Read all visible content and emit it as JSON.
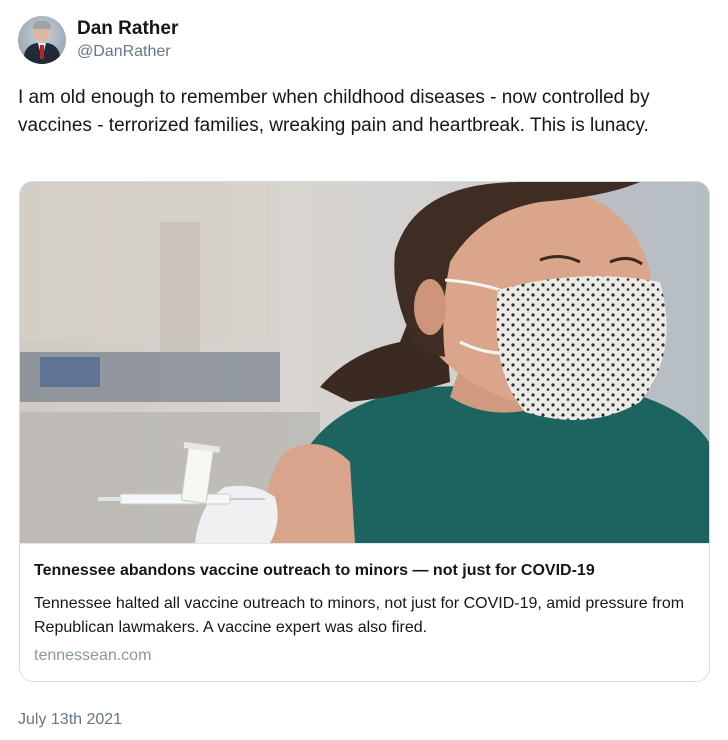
{
  "author": {
    "name": "Dan Rather",
    "handle": "@DanRather"
  },
  "tweet": {
    "text": "I am old enough to remember when childhood diseases - now controlled by vaccines - terrorized families, wreaking pain and heartbreak. This is lunacy.",
    "date": "July 13th 2021"
  },
  "card": {
    "image_icon": "photo-woman-receiving-vaccine",
    "title": "Tennessee abandons vaccine outreach to minors — not just for COVID-19",
    "description": "Tennessee halted all vaccine outreach to minors, not just for COVID-19, amid pressure from Republican lawmakers. A vaccine expert was also fired.",
    "domain": "tennessean.com"
  },
  "colors": {
    "text": "#14171a",
    "secondary": "#657786",
    "border": "#d5dde3",
    "shirt": "#1d6460"
  }
}
